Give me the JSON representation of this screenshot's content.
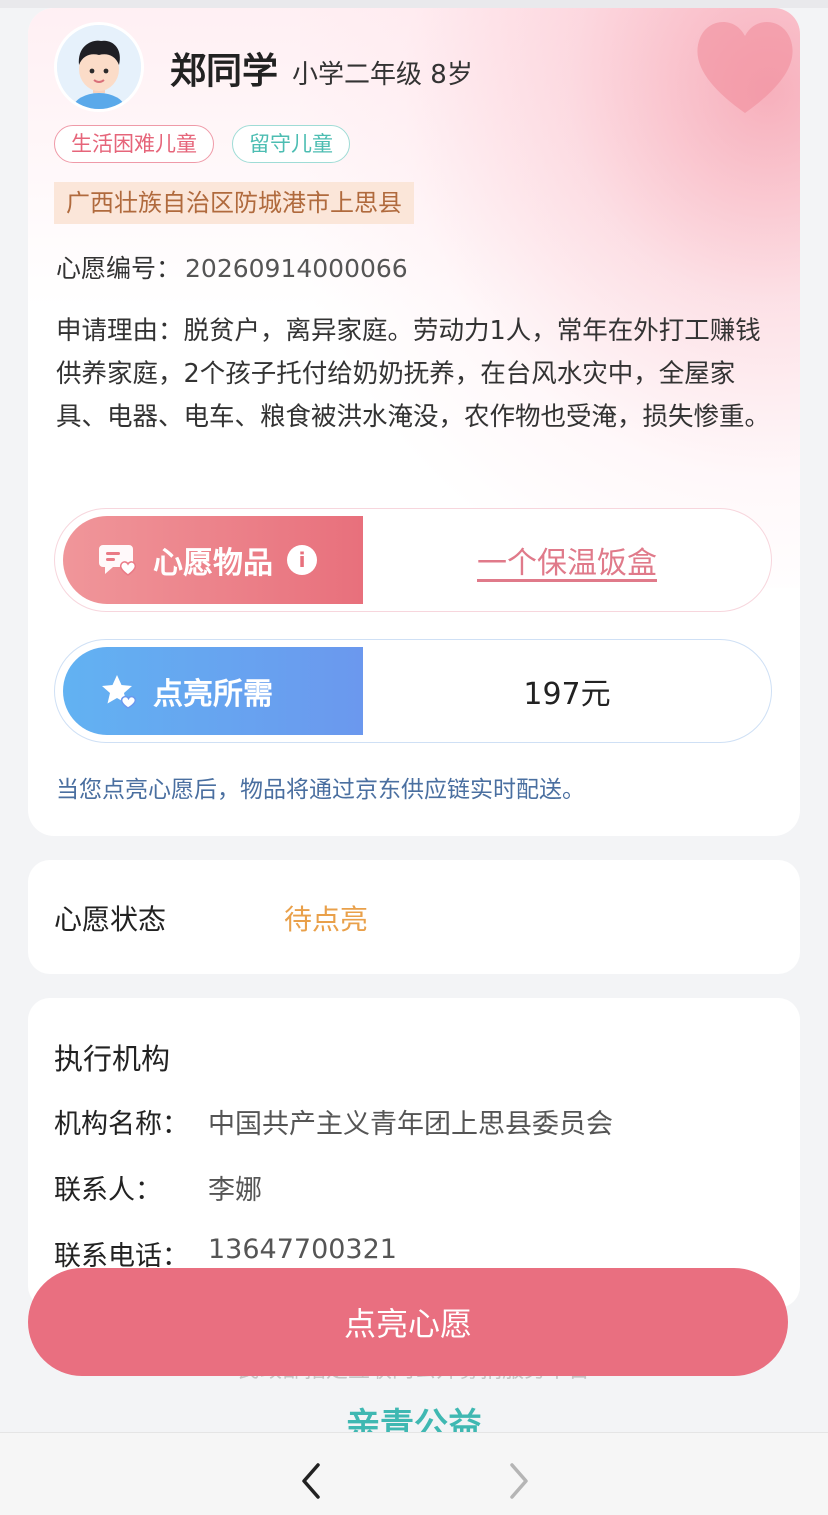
{
  "student": {
    "name": "郑同学",
    "grade_age": "小学二年级 8岁",
    "tags": [
      "生活困难儿童",
      "留守儿童"
    ],
    "region": "广西壮族自治区防城港市上思县"
  },
  "wish": {
    "number_label": "心愿编号：",
    "number": "20260914000066",
    "reason_label": "申请理由：",
    "reason": "脱贫户，离异家庭。劳动力1人，常年在外打工赚钱供养家庭，2个孩子托付给奶奶抚养，在台风水灾中，全屋家具、电器、电车、粮食被洪水淹没，农作物也受淹，损失惨重。",
    "item_label": "心愿物品",
    "item": "一个保温饭盒",
    "need_label": "点亮所需",
    "amount": "197元",
    "delivery_note": "当您点亮心愿后，物品将通过京东供应链实时配送。"
  },
  "status": {
    "label": "心愿状态",
    "value": "待点亮"
  },
  "org": {
    "title": "执行机构",
    "name_label": "机构名称：",
    "name": "中国共产主义青年团上思县委员会",
    "contact_label": "联系人：",
    "contact": "李娜",
    "phone_label": "联系电话：",
    "phone": "13647700321"
  },
  "footer": {
    "text": "民政部指定互联网公开募捐服务平台",
    "logo": "亲青公益"
  },
  "cta_label": "点亮心愿",
  "icons": [
    "avatar",
    "wish-item-icon",
    "info-icon",
    "star-heart-icon",
    "back-arrow-icon",
    "forward-arrow-icon"
  ],
  "colors": {
    "accent_red": "#e96f80",
    "accent_blue": "#6b98ee",
    "status_orange": "#e9a04a",
    "tag_teal": "#4cbdb2"
  }
}
